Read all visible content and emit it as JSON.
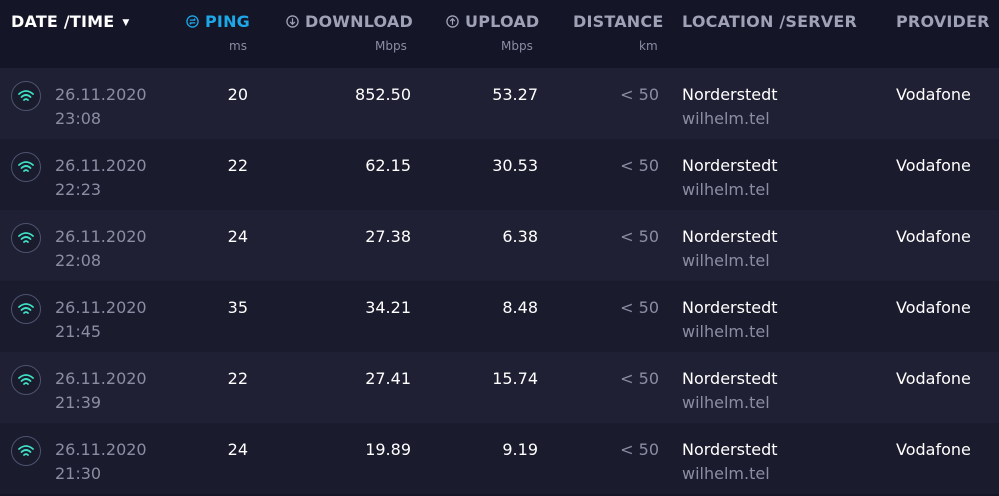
{
  "header": {
    "datetime": "DATE /TIME",
    "ping": "PING",
    "ping_unit": "ms",
    "download": "DOWNLOAD",
    "download_unit": "Mbps",
    "upload": "UPLOAD",
    "upload_unit": "Mbps",
    "distance": "DISTANCE",
    "distance_unit": "km",
    "location": "LOCATION /SERVER",
    "provider": "PROVIDER"
  },
  "colors": {
    "accent": "#1da7e8",
    "wifi_icon": "#3fe0c5",
    "background": "#141526"
  },
  "rows": [
    {
      "date": "26.11.2020",
      "time": "23:08",
      "ping": "20",
      "download": "852.50",
      "upload": "53.27",
      "distance": "< 50",
      "location": "Norderstedt",
      "server": "wilhelm.tel",
      "provider": "Vodafone"
    },
    {
      "date": "26.11.2020",
      "time": "22:23",
      "ping": "22",
      "download": "62.15",
      "upload": "30.53",
      "distance": "< 50",
      "location": "Norderstedt",
      "server": "wilhelm.tel",
      "provider": "Vodafone"
    },
    {
      "date": "26.11.2020",
      "time": "22:08",
      "ping": "24",
      "download": "27.38",
      "upload": "6.38",
      "distance": "< 50",
      "location": "Norderstedt",
      "server": "wilhelm.tel",
      "provider": "Vodafone"
    },
    {
      "date": "26.11.2020",
      "time": "21:45",
      "ping": "35",
      "download": "34.21",
      "upload": "8.48",
      "distance": "< 50",
      "location": "Norderstedt",
      "server": "wilhelm.tel",
      "provider": "Vodafone"
    },
    {
      "date": "26.11.2020",
      "time": "21:39",
      "ping": "22",
      "download": "27.41",
      "upload": "15.74",
      "distance": "< 50",
      "location": "Norderstedt",
      "server": "wilhelm.tel",
      "provider": "Vodafone"
    },
    {
      "date": "26.11.2020",
      "time": "21:30",
      "ping": "24",
      "download": "19.89",
      "upload": "9.19",
      "distance": "< 50",
      "location": "Norderstedt",
      "server": "wilhelm.tel",
      "provider": "Vodafone"
    }
  ]
}
